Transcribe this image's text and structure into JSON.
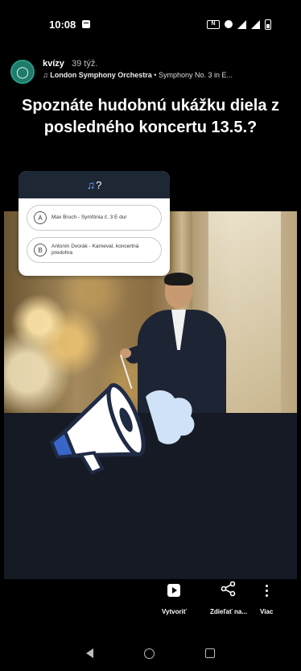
{
  "status_bar": {
    "time": "10:08"
  },
  "post": {
    "channel_name": "kvízy",
    "age": "39 týž.",
    "music_prefix": "♫",
    "music_artist": "London Symphony Orchestra",
    "music_album": "Symphony No. 3 in E...",
    "title": "Spoznáte hudobnú ukážku diela z posledného koncertu 13.5.?"
  },
  "poll": {
    "header_symbol": "?",
    "options": [
      {
        "letter": "A",
        "text": "Max Bruch - Symfónia č. 3 E dur"
      },
      {
        "letter": "B",
        "text": "Antonín Dvorák - Karneval, koncertná predohra"
      }
    ]
  },
  "actions": {
    "create_label": "Vytvoriť",
    "share_label": "Zdieľať na...",
    "more_label": "Viac"
  },
  "colors": {
    "background": "#000000",
    "poll_header": "#1e2734",
    "megaphone_blue": "#3a66c9",
    "cloud_light": "#cfe2f7"
  },
  "icons": [
    "image-icon",
    "nfc-icon",
    "data-saver-icon",
    "wifi-icon",
    "signal-icon",
    "battery-icon",
    "music-note-icon",
    "shorts-create-icon",
    "share-icon",
    "more-vert-icon",
    "nav-back-icon",
    "nav-home-icon",
    "nav-recents-icon"
  ]
}
